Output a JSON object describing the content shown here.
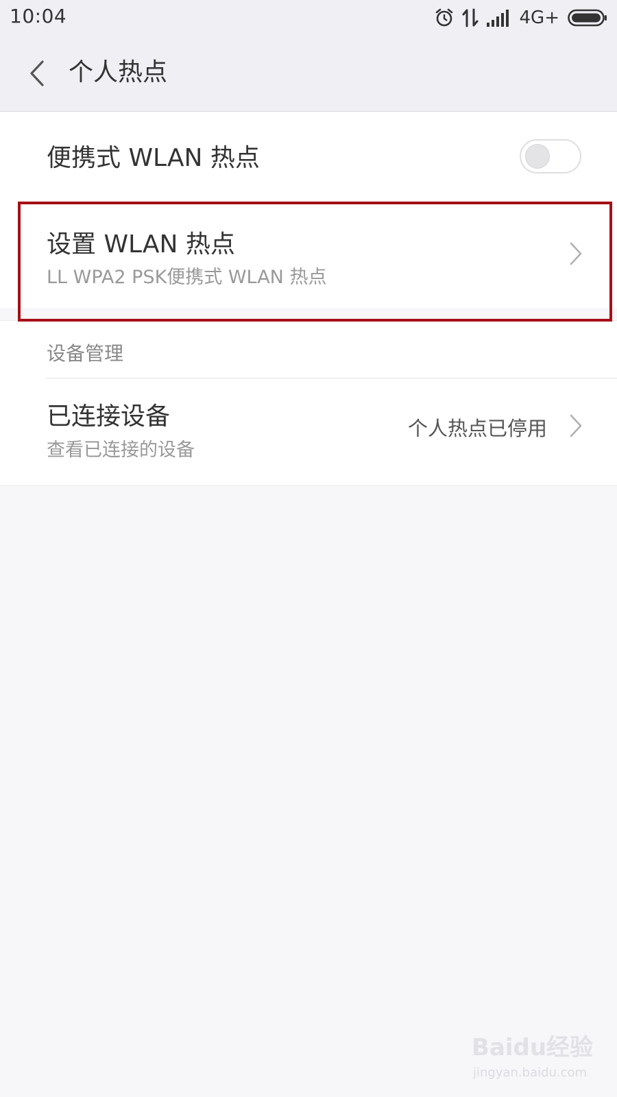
{
  "status_bar": {
    "time": "10:04",
    "network": "4G+",
    "icons": [
      "alarm-icon",
      "data-transfer-icon",
      "signal-icon",
      "battery-icon"
    ]
  },
  "header": {
    "back_icon": "chevron-left-icon",
    "title": "个人热点"
  },
  "portable_hotspot": {
    "label": "便携式 WLAN 热点",
    "toggle_on": false
  },
  "setup_hotspot": {
    "label": "设置 WLAN 热点",
    "subtitle": "LL WPA2 PSK便携式 WLAN 热点"
  },
  "device_section": {
    "header": "设备管理",
    "connected_devices": {
      "label": "已连接设备",
      "subtitle": "查看已连接的设备",
      "status": "个人热点已停用"
    }
  },
  "watermark": {
    "brand": "Baidu经验",
    "url": "jingyan.baidu.com"
  },
  "colors": {
    "highlight": "#a60f17",
    "background": "#f7f6f9",
    "card": "#ffffff",
    "secondary_text": "#999999"
  }
}
